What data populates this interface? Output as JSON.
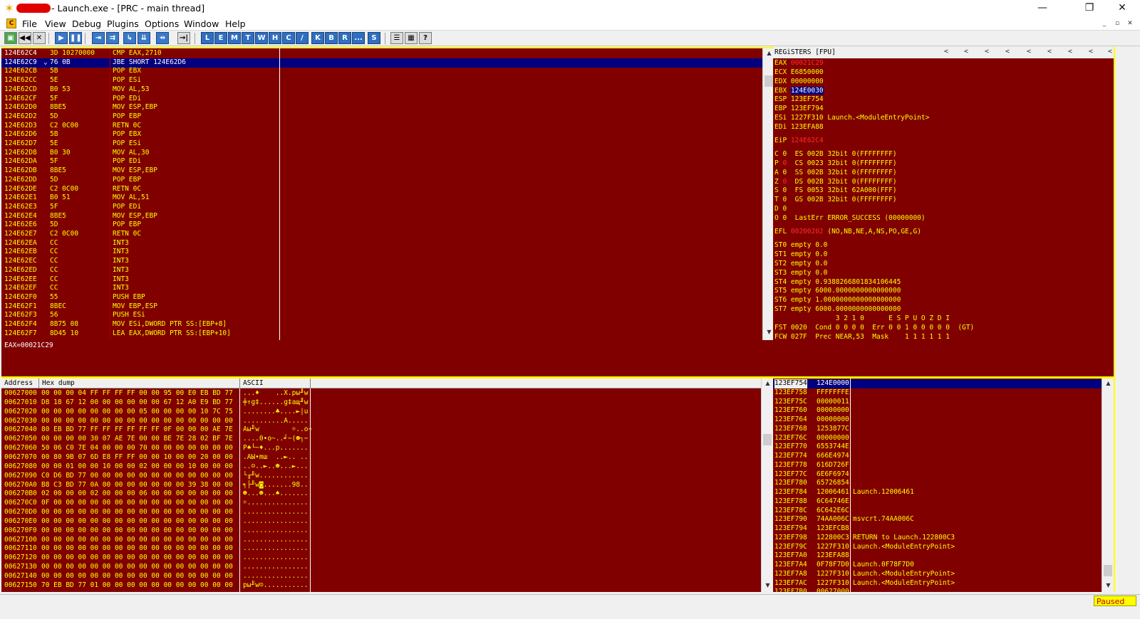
{
  "window": {
    "title": "- Launch.exe - [PRC - main thread]",
    "controls": [
      "—",
      "❐",
      "✕"
    ]
  },
  "menu": {
    "items": [
      "File",
      "View",
      "Debug",
      "Plugins",
      "Options",
      "Window",
      "Help"
    ],
    "mdi_controls": [
      "_",
      "▫",
      "✕"
    ]
  },
  "toolbar": {
    "buttons": [
      {
        "name": "open-icon",
        "glyph": "▣"
      },
      {
        "name": "restart-icon",
        "glyph": "◀◀"
      },
      {
        "name": "close-icon",
        "glyph": "✕"
      },
      {
        "name": "run-icon",
        "glyph": "▶"
      },
      {
        "name": "pause-icon",
        "glyph": "❚❚"
      },
      {
        "name": "step-into-icon",
        "glyph": "⇥"
      },
      {
        "name": "step-over-icon",
        "glyph": "⇉"
      },
      {
        "name": "trace-into-icon",
        "glyph": "↳"
      },
      {
        "name": "trace-over-icon",
        "glyph": "⇊"
      },
      {
        "name": "execute-till-return-icon",
        "glyph": "⇸"
      },
      {
        "name": "goto-icon",
        "glyph": "→|"
      }
    ],
    "letters": [
      "L",
      "E",
      "M",
      "T",
      "W",
      "H",
      "C",
      "/",
      "K",
      "B",
      "R",
      "...",
      "S"
    ],
    "extra": [
      {
        "name": "list-icon",
        "glyph": "☰"
      },
      {
        "name": "grid-icon",
        "glyph": "▦"
      },
      {
        "name": "help-icon",
        "glyph": "?"
      }
    ]
  },
  "cpu": {
    "rows": [
      {
        "addr": "124E62C4",
        "hex": "3D 10270000",
        "cmd": "CMP EAX,2710"
      },
      {
        "addr": "124E62C9",
        "hex": "76 0B",
        "cmd": "JBE SHORT 124E62D6",
        "arrow": "⌄"
      },
      {
        "addr": "124E62CB",
        "hex": "5B",
        "cmd": "POP EBX"
      },
      {
        "addr": "124E62CC",
        "hex": "5E",
        "cmd": "POP ESi"
      },
      {
        "addr": "124E62CD",
        "hex": "B0 53",
        "cmd": "MOV AL,53"
      },
      {
        "addr": "124E62CF",
        "hex": "5F",
        "cmd": "POP EDi"
      },
      {
        "addr": "124E62D0",
        "hex": "8BE5",
        "cmd": "MOV ESP,EBP"
      },
      {
        "addr": "124E62D2",
        "hex": "5D",
        "cmd": "POP EBP"
      },
      {
        "addr": "124E62D3",
        "hex": "C2 0C00",
        "cmd": "RETN 0C"
      },
      {
        "addr": "124E62D6",
        "hex": "5B",
        "cmd": "POP EBX"
      },
      {
        "addr": "124E62D7",
        "hex": "5E",
        "cmd": "POP ESi"
      },
      {
        "addr": "124E62D8",
        "hex": "B0 30",
        "cmd": "MOV AL,30"
      },
      {
        "addr": "124E62DA",
        "hex": "5F",
        "cmd": "POP EDi"
      },
      {
        "addr": "124E62DB",
        "hex": "8BE5",
        "cmd": "MOV ESP,EBP"
      },
      {
        "addr": "124E62DD",
        "hex": "5D",
        "cmd": "POP EBP"
      },
      {
        "addr": "124E62DE",
        "hex": "C2 0C00",
        "cmd": "RETN 0C"
      },
      {
        "addr": "124E62E1",
        "hex": "B0 51",
        "cmd": "MOV AL,51"
      },
      {
        "addr": "124E62E3",
        "hex": "5F",
        "cmd": "POP EDi"
      },
      {
        "addr": "124E62E4",
        "hex": "8BE5",
        "cmd": "MOV ESP,EBP"
      },
      {
        "addr": "124E62E6",
        "hex": "5D",
        "cmd": "POP EBP"
      },
      {
        "addr": "124E62E7",
        "hex": "C2 0C00",
        "cmd": "RETN 0C"
      },
      {
        "addr": "124E62EA",
        "hex": "CC",
        "cmd": "INT3"
      },
      {
        "addr": "124E62EB",
        "hex": "CC",
        "cmd": "INT3"
      },
      {
        "addr": "124E62EC",
        "hex": "CC",
        "cmd": "INT3"
      },
      {
        "addr": "124E62ED",
        "hex": "CC",
        "cmd": "INT3"
      },
      {
        "addr": "124E62EE",
        "hex": "CC",
        "cmd": "INT3"
      },
      {
        "addr": "124E62EF",
        "hex": "CC",
        "cmd": "INT3"
      },
      {
        "addr": "124E62F0",
        "hex": "55",
        "cmd": "PUSH EBP"
      },
      {
        "addr": "124E62F1",
        "hex": "8BEC",
        "cmd": "MOV EBP,ESP"
      },
      {
        "addr": "124E62F3",
        "hex": "56",
        "cmd": "PUSH ESi"
      },
      {
        "addr": "124E62F4",
        "hex": "8B75 08",
        "cmd": "MOV ESi,DWORD PTR SS:[EBP+8]"
      },
      {
        "addr": "124E62F7",
        "hex": "8D45 10",
        "cmd": "LEA EAX,DWORD PTR SS:[EBP+10]"
      }
    ]
  },
  "info": {
    "text": "EAX=00021C29"
  },
  "registers": {
    "header": "REGiSTERS [FPU]",
    "arrows": [
      "<",
      "<",
      "<",
      "<",
      "<",
      "<",
      "<",
      "<",
      "<"
    ],
    "lines": [
      {
        "pre": "EAX ",
        "red": "00021C29",
        "post": ""
      },
      {
        "pre": "ECX E6850000",
        "red": "",
        "post": ""
      },
      {
        "pre": "EDX 00000000",
        "red": "",
        "post": ""
      },
      {
        "pre": "EBX ",
        "hl": "124E0030",
        "post": ""
      },
      {
        "pre": "ESP 123EF754",
        "red": "",
        "post": ""
      },
      {
        "pre": "EBP 123EF794",
        "red": "",
        "post": ""
      },
      {
        "pre": "ESi 1227F310 Launch.<ModuleEntryPoint>",
        "red": "",
        "post": ""
      },
      {
        "pre": "EDi 123EFA88",
        "red": "",
        "post": ""
      },
      {
        "pre": "",
        "red": "",
        "post": ""
      },
      {
        "pre": "EiP ",
        "red": "124E62C4",
        "post": ""
      },
      {
        "pre": "",
        "red": "",
        "post": ""
      },
      {
        "pre": "C 0  ES 002B 32bit 0(FFFFFFFF)",
        "red": "",
        "post": ""
      },
      {
        "pre": "P ",
        "red": "0",
        "post": "  CS 0023 32bit 0(FFFFFFFF)"
      },
      {
        "pre": "A 0  SS 002B 32bit 0(FFFFFFFF)",
        "red": "",
        "post": ""
      },
      {
        "pre": "Z ",
        "red": "0",
        "post": "  DS 002B 32bit 0(FFFFFFFF)"
      },
      {
        "pre": "S 0  FS 0053 32bit 62A000(FFF)",
        "red": "",
        "post": ""
      },
      {
        "pre": "T 0  GS 002B 32bit 0(FFFFFFFF)",
        "red": "",
        "post": ""
      },
      {
        "pre": "D 0",
        "red": "",
        "post": ""
      },
      {
        "pre": "O 0  LastErr ERROR_SUCCESS (00000000)",
        "red": "",
        "post": ""
      },
      {
        "pre": "",
        "red": "",
        "post": ""
      },
      {
        "pre": "EFL ",
        "red": "00200202",
        "post": " (NO,NB,NE,A,NS,PO,GE,G)"
      },
      {
        "pre": "",
        "red": "",
        "post": ""
      },
      {
        "pre": "ST0 empty 0.0",
        "red": "",
        "post": ""
      },
      {
        "pre": "ST1 empty 0.0",
        "red": "",
        "post": ""
      },
      {
        "pre": "ST2 empty 0.0",
        "red": "",
        "post": ""
      },
      {
        "pre": "ST3 empty 0.0",
        "red": "",
        "post": ""
      },
      {
        "pre": "ST4 empty 0.9388266801834106445",
        "red": "",
        "post": ""
      },
      {
        "pre": "ST5 empty 6000.0000000000000000",
        "red": "",
        "post": ""
      },
      {
        "pre": "ST6 empty 1.0000000000000000000",
        "red": "",
        "post": ""
      },
      {
        "pre": "ST7 empty 6000.0000000000000000",
        "red": "",
        "post": ""
      },
      {
        "pre": "               3 2 1 0      E S P U O Z D I",
        "red": "",
        "post": ""
      },
      {
        "pre": "FST 0020  Cond 0 0 0 0  Err 0 0 1 0 0 0 0 0  (GT)",
        "red": "",
        "post": ""
      },
      {
        "pre": "FCW 027F  Prec NEAR,53  Mask    1 1 1 1 1 1",
        "red": "",
        "post": ""
      }
    ]
  },
  "dump": {
    "headers": [
      "Address",
      "Hex dump",
      "ASCII"
    ],
    "rows": [
      {
        "addr": "00627000",
        "hex": "00 00 00 04|FF FF FF FF|00 00 95 00|E0 EB BD 77|",
        "ascii": "...♦    ..X.pы╜w"
      },
      {
        "addr": "00627010",
        "hex": "D8 18 67 12|00 00 00 00|00 00 67 12|A0 E9 BD 77|",
        "ascii": "╪↑g‡......g‡ащ╜w"
      },
      {
        "addr": "00627020",
        "hex": "00 00 00 00|00 00 00 00|05 00 00 00|00 10 7C 75|",
        "ascii": "........♣....►|u"
      },
      {
        "addr": "00627030",
        "hex": "00 00 00 00|00 00 00 00|00 00 00 00|00 00 00 00|",
        "ascii": "..........A....."
      },
      {
        "addr": "00627040",
        "hex": "80 EB BD 77|FF FF FF FF|FF FF 0F 00|00 00 AE 7E|",
        "ascii": "Аы╜w        ☼..о~"
      },
      {
        "addr": "00627050",
        "hex": "00 00 00 00|30 07 AE 7E|00 00 BE 7E|28 02 BF 7E|",
        "ascii": "....0•о~..╛~(☻┐~"
      },
      {
        "addr": "00627060",
        "hex": "50 06 C0 7E|04 00 00 00|70 00 00 00|00 00 00 00|",
        "ascii": "P♠└~♦...p......."
      },
      {
        "addr": "00627070",
        "hex": "00 80 9B 07|6D E8 FF FF|00 00 10 00|00 20 00 00|",
        "ascii": ".АЫ•mш  ..►.. .."
      },
      {
        "addr": "00627080",
        "hex": "00 00 01 00|00 10 00 00|02 00 00 00|10 00 00 00|",
        "ascii": "..☺..►..☻...►..."
      },
      {
        "addr": "00627090",
        "hex": "C0 D6 BD 77|00 00 00 00|00 00 00 00|00 00 00 00|",
        "ascii": "└╓╜w............"
      },
      {
        "addr": "006270A0",
        "hex": "B8 C3 BD 77|0A 00 00 00|00 00 00 00|39 38 00 00|",
        "ascii": "╕├╜w◙.......98.."
      },
      {
        "addr": "006270B0",
        "hex": "02 00 00 00|02 00 00 00|06 00 00 00|00 00 00 00|",
        "ascii": "☻...☻...♠......."
      },
      {
        "addr": "006270C0",
        "hex": "0F 00 00 00|00 00 00 00|00 00 00 00|00 00 00 00|",
        "ascii": "☼..............."
      },
      {
        "addr": "006270D0",
        "hex": "00 00 00 00|00 00 00 00|00 00 00 00|00 00 00 00|",
        "ascii": "................"
      },
      {
        "addr": "006270E0",
        "hex": "00 00 00 00|00 00 00 00|00 00 00 00|00 00 00 00|",
        "ascii": "................"
      },
      {
        "addr": "006270F0",
        "hex": "00 00 00 00|00 00 00 00|00 00 00 00|00 00 00 00|",
        "ascii": "................"
      },
      {
        "addr": "00627100",
        "hex": "00 00 00 00|00 00 00 00|00 00 00 00|00 00 00 00|",
        "ascii": "................"
      },
      {
        "addr": "00627110",
        "hex": "00 00 00 00|00 00 00 00|00 00 00 00|00 00 00 00|",
        "ascii": "................"
      },
      {
        "addr": "00627120",
        "hex": "00 00 00 00|00 00 00 00|00 00 00 00|00 00 00 00|",
        "ascii": "................"
      },
      {
        "addr": "00627130",
        "hex": "00 00 00 00|00 00 00 00|00 00 00 00|00 00 00 00|",
        "ascii": "................"
      },
      {
        "addr": "00627140",
        "hex": "00 00 00 00|00 00 00 00|00 00 00 00|00 00 00 00|",
        "ascii": "................"
      },
      {
        "addr": "00627150",
        "hex": "70 EB BD 77|01 00 00 00|00 00 00 00|00 00 00 00|",
        "ascii": "pы╜w☺..........."
      }
    ]
  },
  "stack": {
    "rows": [
      {
        "addr": "123EF754",
        "val": "124E0000",
        "com": ""
      },
      {
        "addr": "123EF758",
        "val": "FFFFFFFE",
        "com": ""
      },
      {
        "addr": "123EF75C",
        "val": "00000011",
        "com": ""
      },
      {
        "addr": "123EF760",
        "val": "00000000",
        "com": ""
      },
      {
        "addr": "123EF764",
        "val": "00000000",
        "com": ""
      },
      {
        "addr": "123EF768",
        "val": "1253877C",
        "com": ""
      },
      {
        "addr": "123EF76C",
        "val": "00000000",
        "com": ""
      },
      {
        "addr": "123EF770",
        "val": "6553744E",
        "com": ""
      },
      {
        "addr": "123EF774",
        "val": "666E4974",
        "com": ""
      },
      {
        "addr": "123EF778",
        "val": "616D726F",
        "com": ""
      },
      {
        "addr": "123EF77C",
        "val": "6E6F6974",
        "com": ""
      },
      {
        "addr": "123EF780",
        "val": "65726854",
        "com": ""
      },
      {
        "addr": "123EF784",
        "val": "12006461",
        "com": "Launch.12006461"
      },
      {
        "addr": "123EF788",
        "val": "6C64746E",
        "com": ""
      },
      {
        "addr": "123EF78C",
        "val": "6C642E6C",
        "com": ""
      },
      {
        "addr": "123EF790",
        "val": "74AA006C",
        "com": "msvcrt.74AA006C"
      },
      {
        "addr": "123EF794",
        "val": "123EFCB8",
        "com": ""
      },
      {
        "addr": "123EF798",
        "val": "122800C3",
        "com": "RETURN to Launch.122800C3"
      },
      {
        "addr": "123EF79C",
        "val": "1227F310",
        "com": "Launch.<ModuleEntryPoint>"
      },
      {
        "addr": "123EF7A0",
        "val": "123EFA88",
        "com": ""
      },
      {
        "addr": "123EF7A4",
        "val": "0F78F7D0",
        "com": "Launch.0F78F7D0"
      },
      {
        "addr": "123EF7A8",
        "val": "1227F310",
        "com": "Launch.<ModuleEntryPoint>"
      },
      {
        "addr": "123EF7AC",
        "val": "1227F310",
        "com": "Launch.<ModuleEntryPoint>"
      },
      {
        "addr": "123EF7B0",
        "val": "00627000",
        "com": ""
      }
    ]
  },
  "status": {
    "state": "Paused"
  }
}
